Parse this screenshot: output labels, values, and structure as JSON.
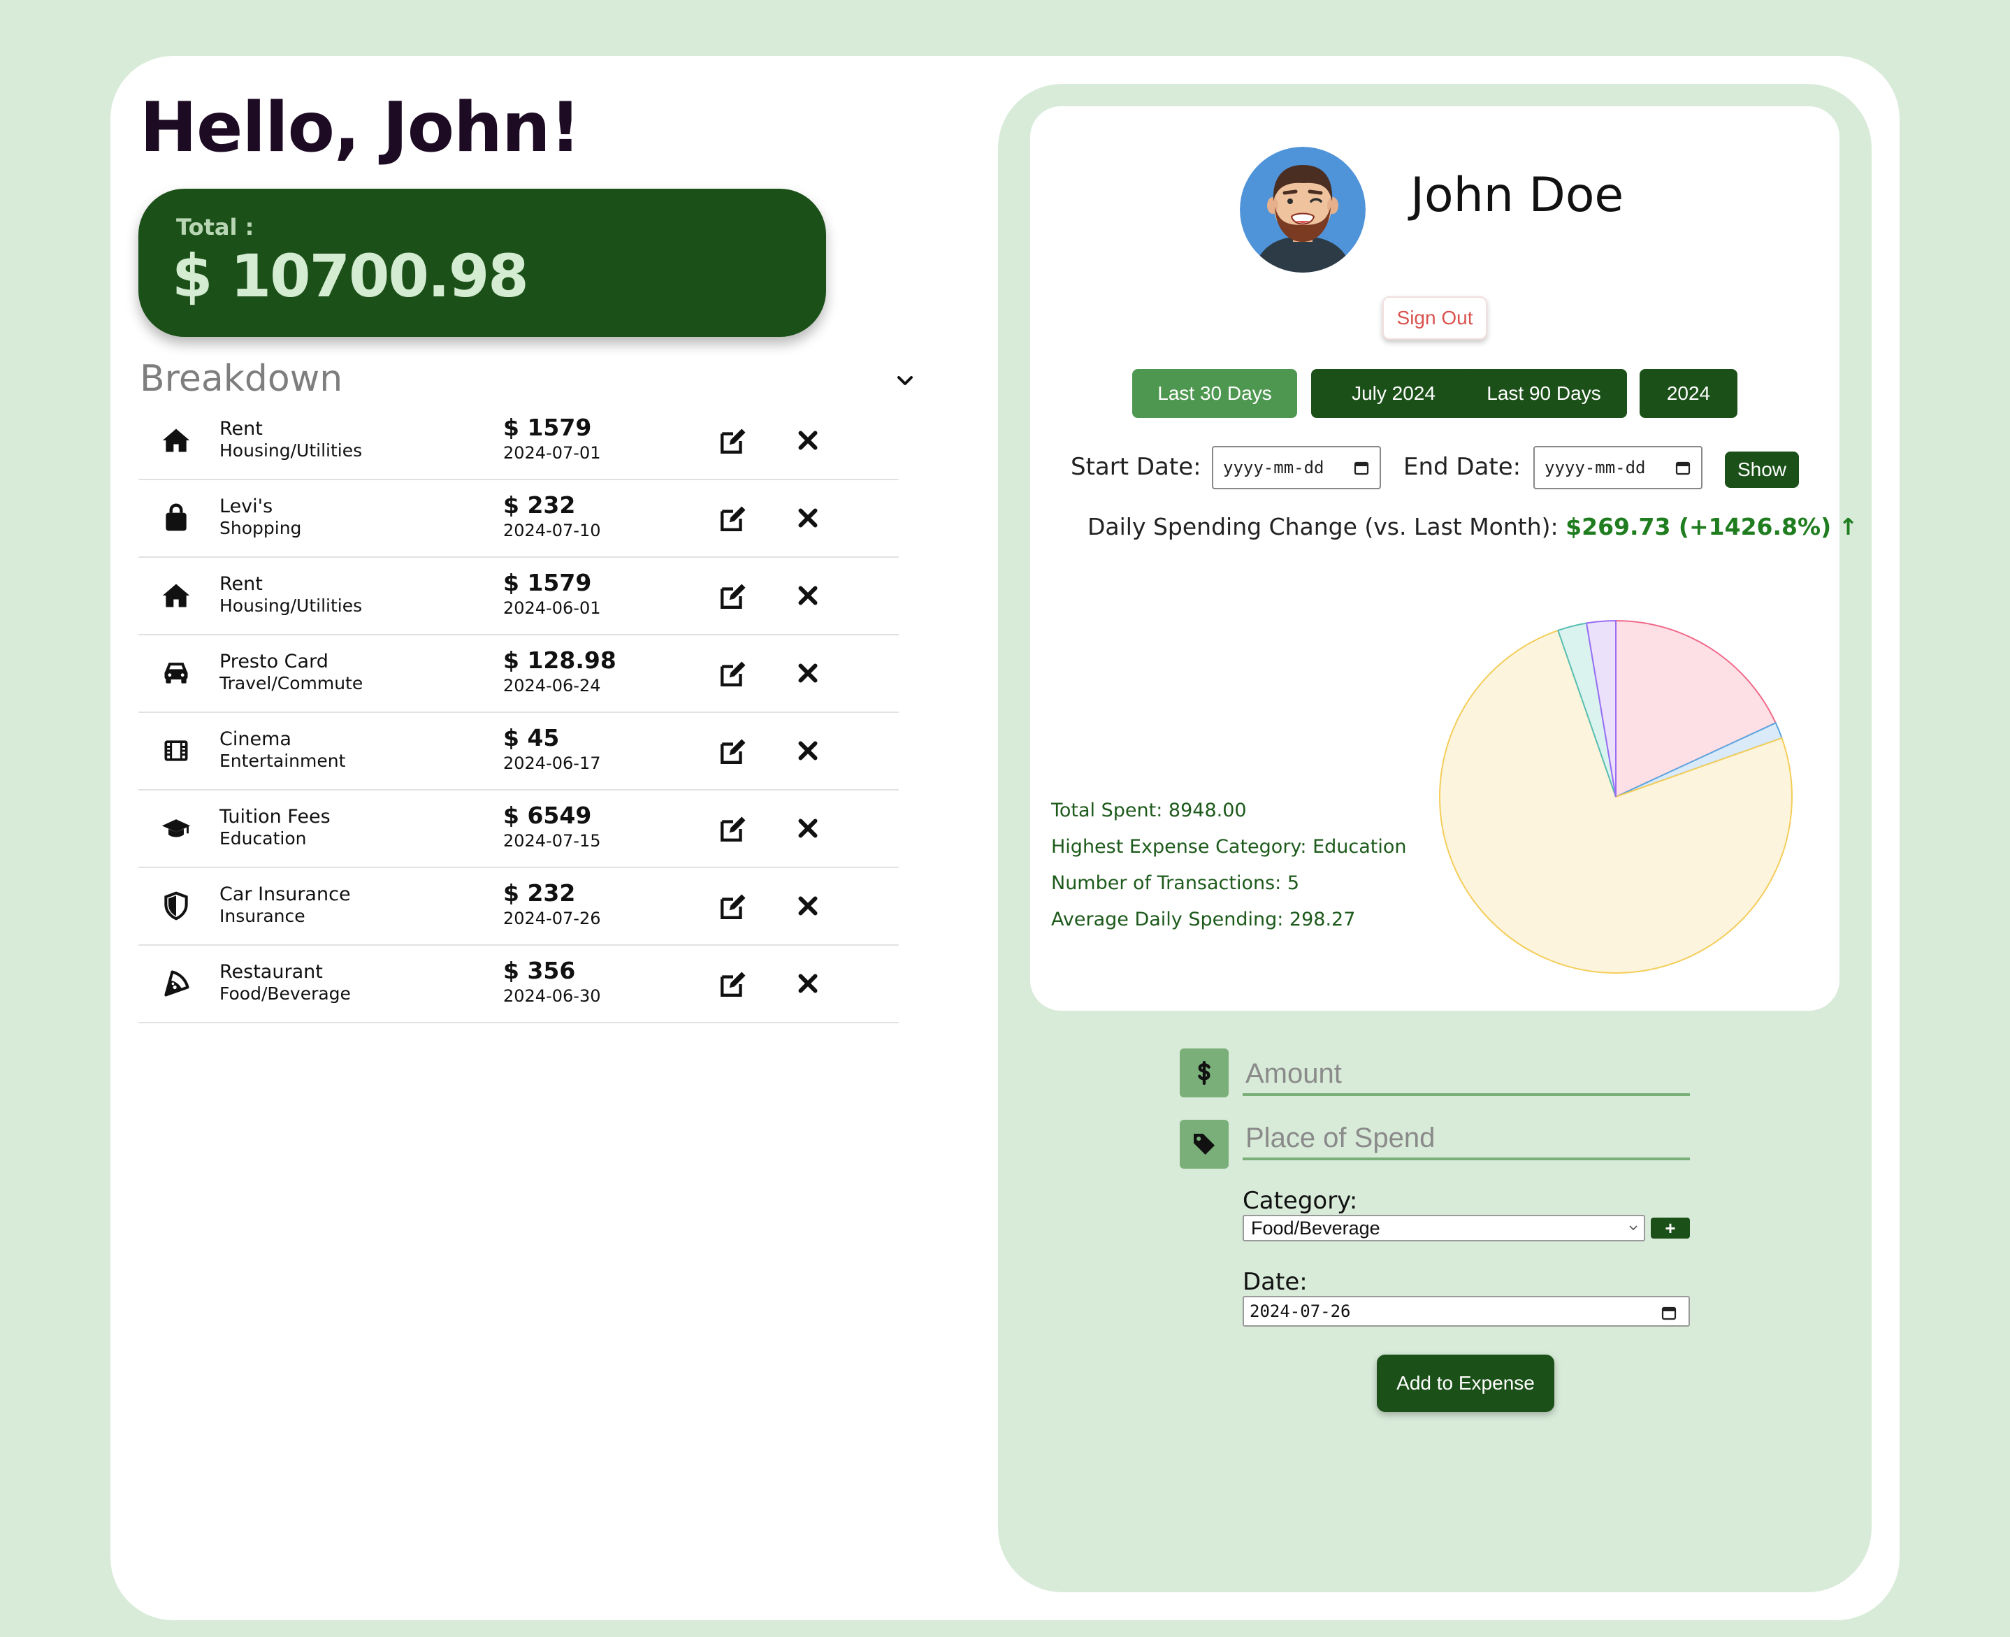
{
  "greeting": "Hello, John!",
  "total": {
    "label": "Total :",
    "value": "$ 10700.98"
  },
  "breakdown": {
    "title": "Breakdown",
    "items": [
      {
        "icon": "house-icon",
        "name": "Rent",
        "category": "Housing/Utilities",
        "amount": "$ 1579",
        "date": "2024-07-01"
      },
      {
        "icon": "shopping-bag-icon",
        "name": "Levi's",
        "category": "Shopping",
        "amount": "$ 232",
        "date": "2024-07-10"
      },
      {
        "icon": "house-icon",
        "name": "Rent",
        "category": "Housing/Utilities",
        "amount": "$ 1579",
        "date": "2024-06-01"
      },
      {
        "icon": "car-icon",
        "name": "Presto Card",
        "category": "Travel/Commute",
        "amount": "$ 128.98",
        "date": "2024-06-24"
      },
      {
        "icon": "film-icon",
        "name": "Cinema",
        "category": "Entertainment",
        "amount": "$ 45",
        "date": "2024-06-17"
      },
      {
        "icon": "graduation-cap-icon",
        "name": "Tuition Fees",
        "category": "Education",
        "amount": "$ 6549",
        "date": "2024-07-15"
      },
      {
        "icon": "shield-icon",
        "name": "Car Insurance",
        "category": "Insurance",
        "amount": "$ 232",
        "date": "2024-07-26"
      },
      {
        "icon": "pizza-icon",
        "name": "Restaurant",
        "category": "Food/Beverage",
        "amount": "$ 356",
        "date": "2024-06-30"
      }
    ]
  },
  "profile": {
    "name": "John Doe",
    "sign_out": "Sign Out"
  },
  "ranges": [
    {
      "label": "Last 30 Days",
      "active": true
    },
    {
      "label": "July 2024",
      "active": false
    },
    {
      "label": "Last 90 Days",
      "active": false
    },
    {
      "label": "2024",
      "active": false
    }
  ],
  "custom_range": {
    "start_label": "Start Date:",
    "end_label": "End Date:",
    "start_value": "yyyy-mm-dd",
    "end_value": "yyyy-mm-dd",
    "show_label": "Show"
  },
  "daily_change": {
    "label": "Daily Spending Change (vs. Last Month):",
    "value": "$269.73 (+1426.8%)",
    "arrow": "↑"
  },
  "stats": [
    "Total Spent: 8948.00",
    "Highest Expense Category: Education",
    "Number of Transactions: 5",
    "Average Daily Spending: 298.27"
  ],
  "chart_data": {
    "type": "pie",
    "slices": [
      {
        "value": 1579,
        "fill": "#fde0e6",
        "stroke": "#f06a8a"
      },
      {
        "value": 128.98,
        "fill": "#dbeaf8",
        "stroke": "#5aa5e0"
      },
      {
        "value": 6549,
        "fill": "#fdf4dd",
        "stroke": "#f4cd5a"
      },
      {
        "value": 232,
        "fill": "#dbf3ef",
        "stroke": "#57bfb4"
      },
      {
        "value": 232,
        "fill": "#ebe1fb",
        "stroke": "#9a6df5"
      }
    ]
  },
  "form": {
    "amount_placeholder": "Amount",
    "place_placeholder": "Place of Spend",
    "category_label": "Category:",
    "category_value": "Food/Beverage",
    "add_category": "+",
    "date_label": "Date:",
    "date_value": "2024-07-26",
    "submit": "Add to Expense"
  },
  "colors": {
    "primary": "#1b5018",
    "accent": "#4e9750",
    "background": "#d8ebd9"
  }
}
